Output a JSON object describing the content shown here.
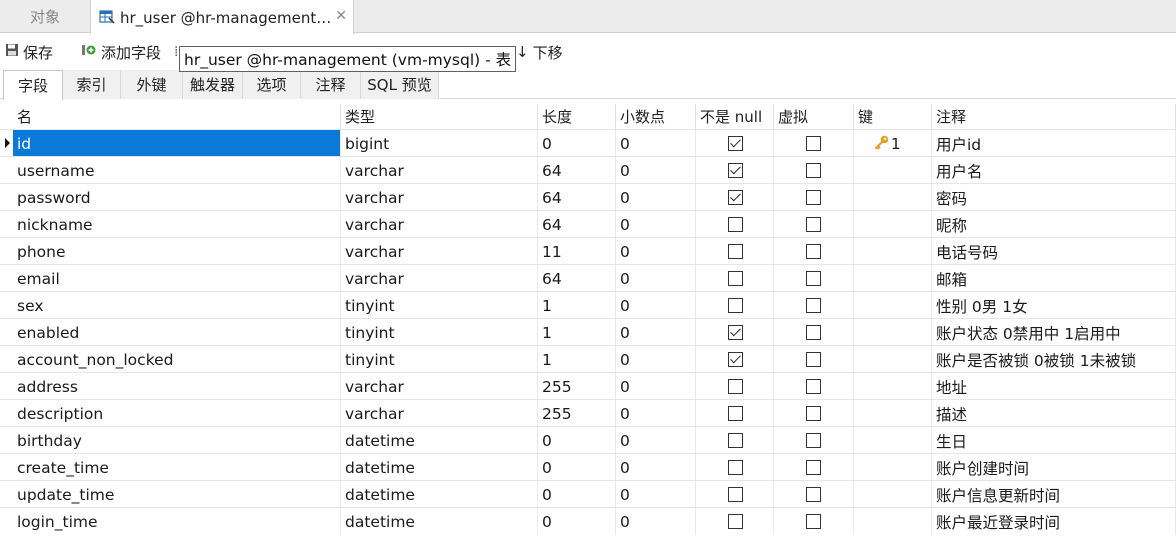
{
  "doc_tabs": {
    "objects_label": "对象",
    "active_label": "hr_user @hr-management (vm-mysql) - 表"
  },
  "toolbar": {
    "save_label": "保存",
    "add_field_label": "添加字段",
    "move_down_label": "下移",
    "tooltip": "hr_user @hr-management (vm-mysql) - 表"
  },
  "sub_tabs": [
    "字段",
    "索引",
    "外键",
    "触发器",
    "选项",
    "注释",
    "SQL 预览"
  ],
  "columns": [
    "名",
    "类型",
    "长度",
    "小数点",
    "不是 null",
    "虚拟",
    "键",
    "注释"
  ],
  "rows": [
    {
      "name": "id",
      "type": "bigint",
      "length": "0",
      "decimals": "0",
      "not_null": true,
      "virtual": false,
      "key": "1",
      "comment": "用户id"
    },
    {
      "name": "username",
      "type": "varchar",
      "length": "64",
      "decimals": "0",
      "not_null": true,
      "virtual": false,
      "key": "",
      "comment": "用户名"
    },
    {
      "name": "password",
      "type": "varchar",
      "length": "64",
      "decimals": "0",
      "not_null": true,
      "virtual": false,
      "key": "",
      "comment": "密码"
    },
    {
      "name": "nickname",
      "type": "varchar",
      "length": "64",
      "decimals": "0",
      "not_null": false,
      "virtual": false,
      "key": "",
      "comment": "昵称"
    },
    {
      "name": "phone",
      "type": "varchar",
      "length": "11",
      "decimals": "0",
      "not_null": false,
      "virtual": false,
      "key": "",
      "comment": "电话号码"
    },
    {
      "name": "email",
      "type": "varchar",
      "length": "64",
      "decimals": "0",
      "not_null": false,
      "virtual": false,
      "key": "",
      "comment": "邮箱"
    },
    {
      "name": "sex",
      "type": "tinyint",
      "length": "1",
      "decimals": "0",
      "not_null": false,
      "virtual": false,
      "key": "",
      "comment": "性别 0男 1女"
    },
    {
      "name": "enabled",
      "type": "tinyint",
      "length": "1",
      "decimals": "0",
      "not_null": true,
      "virtual": false,
      "key": "",
      "comment": "账户状态 0禁用中 1启用中"
    },
    {
      "name": "account_non_locked",
      "type": "tinyint",
      "length": "1",
      "decimals": "0",
      "not_null": true,
      "virtual": false,
      "key": "",
      "comment": "账户是否被锁 0被锁 1未被锁"
    },
    {
      "name": "address",
      "type": "varchar",
      "length": "255",
      "decimals": "0",
      "not_null": false,
      "virtual": false,
      "key": "",
      "comment": "地址"
    },
    {
      "name": "description",
      "type": "varchar",
      "length": "255",
      "decimals": "0",
      "not_null": false,
      "virtual": false,
      "key": "",
      "comment": "描述"
    },
    {
      "name": "birthday",
      "type": "datetime",
      "length": "0",
      "decimals": "0",
      "not_null": false,
      "virtual": false,
      "key": "",
      "comment": "生日"
    },
    {
      "name": "create_time",
      "type": "datetime",
      "length": "0",
      "decimals": "0",
      "not_null": false,
      "virtual": false,
      "key": "",
      "comment": "账户创建时间"
    },
    {
      "name": "update_time",
      "type": "datetime",
      "length": "0",
      "decimals": "0",
      "not_null": false,
      "virtual": false,
      "key": "",
      "comment": "账户信息更新时间"
    },
    {
      "name": "login_time",
      "type": "datetime",
      "length": "0",
      "decimals": "0",
      "not_null": false,
      "virtual": false,
      "key": "",
      "comment": "账户最近登录时间"
    }
  ],
  "icons": {
    "table": "table-icon",
    "save": "save-icon",
    "add_field": "add-field-icon",
    "move_down": "arrow-down-icon",
    "key": "key-icon"
  },
  "colors": {
    "selection": "#0a79d8",
    "key": "#e0a020"
  }
}
